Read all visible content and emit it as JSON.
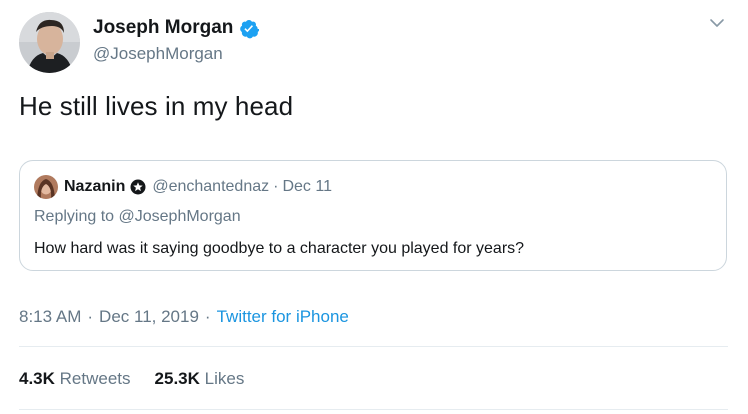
{
  "author": {
    "display_name": "Joseph Morgan",
    "handle": "@JosephMorgan",
    "verified_icon": "verified-badge-icon"
  },
  "tweet": {
    "text": "He still lives in my head"
  },
  "quoted": {
    "display_name": "Nazanin",
    "handle": "@enchantednaz",
    "separator": "·",
    "date": "Dec 11",
    "badge_icon": "star-badge-icon",
    "replying_prefix": "Replying to",
    "replying_to": "@JosephMorgan",
    "text": "How hard was it saying goodbye to a character you played for years?"
  },
  "meta": {
    "time": "8:13 AM",
    "separator": "·",
    "date": "Dec 11, 2019",
    "separator2": "·",
    "source": "Twitter for iPhone"
  },
  "stats": {
    "retweets_count": "4.3K",
    "retweets_label": "Retweets",
    "likes_count": "25.3K",
    "likes_label": "Likes"
  },
  "colors": {
    "accent": "#1da1f2",
    "link": "#1b95e0",
    "secondary_text": "#657786",
    "border": "#ccd6dd"
  }
}
